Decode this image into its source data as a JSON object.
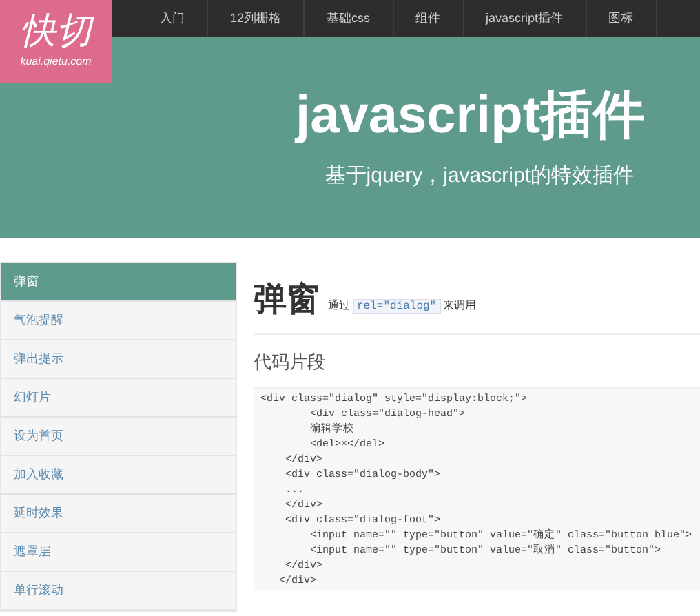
{
  "logo": {
    "title": "快切",
    "subtitle": "kuai.qietu.com"
  },
  "nav": [
    {
      "label": "入门"
    },
    {
      "label": "12列栅格"
    },
    {
      "label": "基础css"
    },
    {
      "label": "组件"
    },
    {
      "label": "javascript插件"
    },
    {
      "label": "图标"
    }
  ],
  "hero": {
    "title": "javascript插件",
    "subtitle": "基于jquery，javascript的特效插件"
  },
  "sidebar": {
    "items": [
      {
        "label": "弹窗",
        "selected": true
      },
      {
        "label": "气泡提醒",
        "selected": false
      },
      {
        "label": "弹出提示",
        "selected": false
      },
      {
        "label": "幻灯片",
        "selected": false
      },
      {
        "label": "设为首页",
        "selected": false
      },
      {
        "label": "加入收藏",
        "selected": false
      },
      {
        "label": "延时效果",
        "selected": false
      },
      {
        "label": "遮罩层",
        "selected": false
      },
      {
        "label": "单行滚动",
        "selected": false
      }
    ]
  },
  "content": {
    "title": "弹窗",
    "note_before": "通过",
    "note_code": "rel=\"dialog\"",
    "note_after": "来调用",
    "section": "代码片段",
    "code_lines": [
      "<div class=\"dialog\" style=\"display:block;\">",
      "        <div class=\"dialog-head\">",
      "        编辑学校",
      "        <del>×</del>",
      "    </div>",
      "    <div class=\"dialog-body\">",
      "    ...",
      "    </div>",
      "    <div class=\"dialog-foot\">",
      "        <input name=\"\" type=\"button\" value=\"确定\" class=\"button blue\">",
      "        <input name=\"\" type=\"button\" value=\"取消\" class=\"button\">",
      "    </div>",
      "   </div>"
    ]
  }
}
